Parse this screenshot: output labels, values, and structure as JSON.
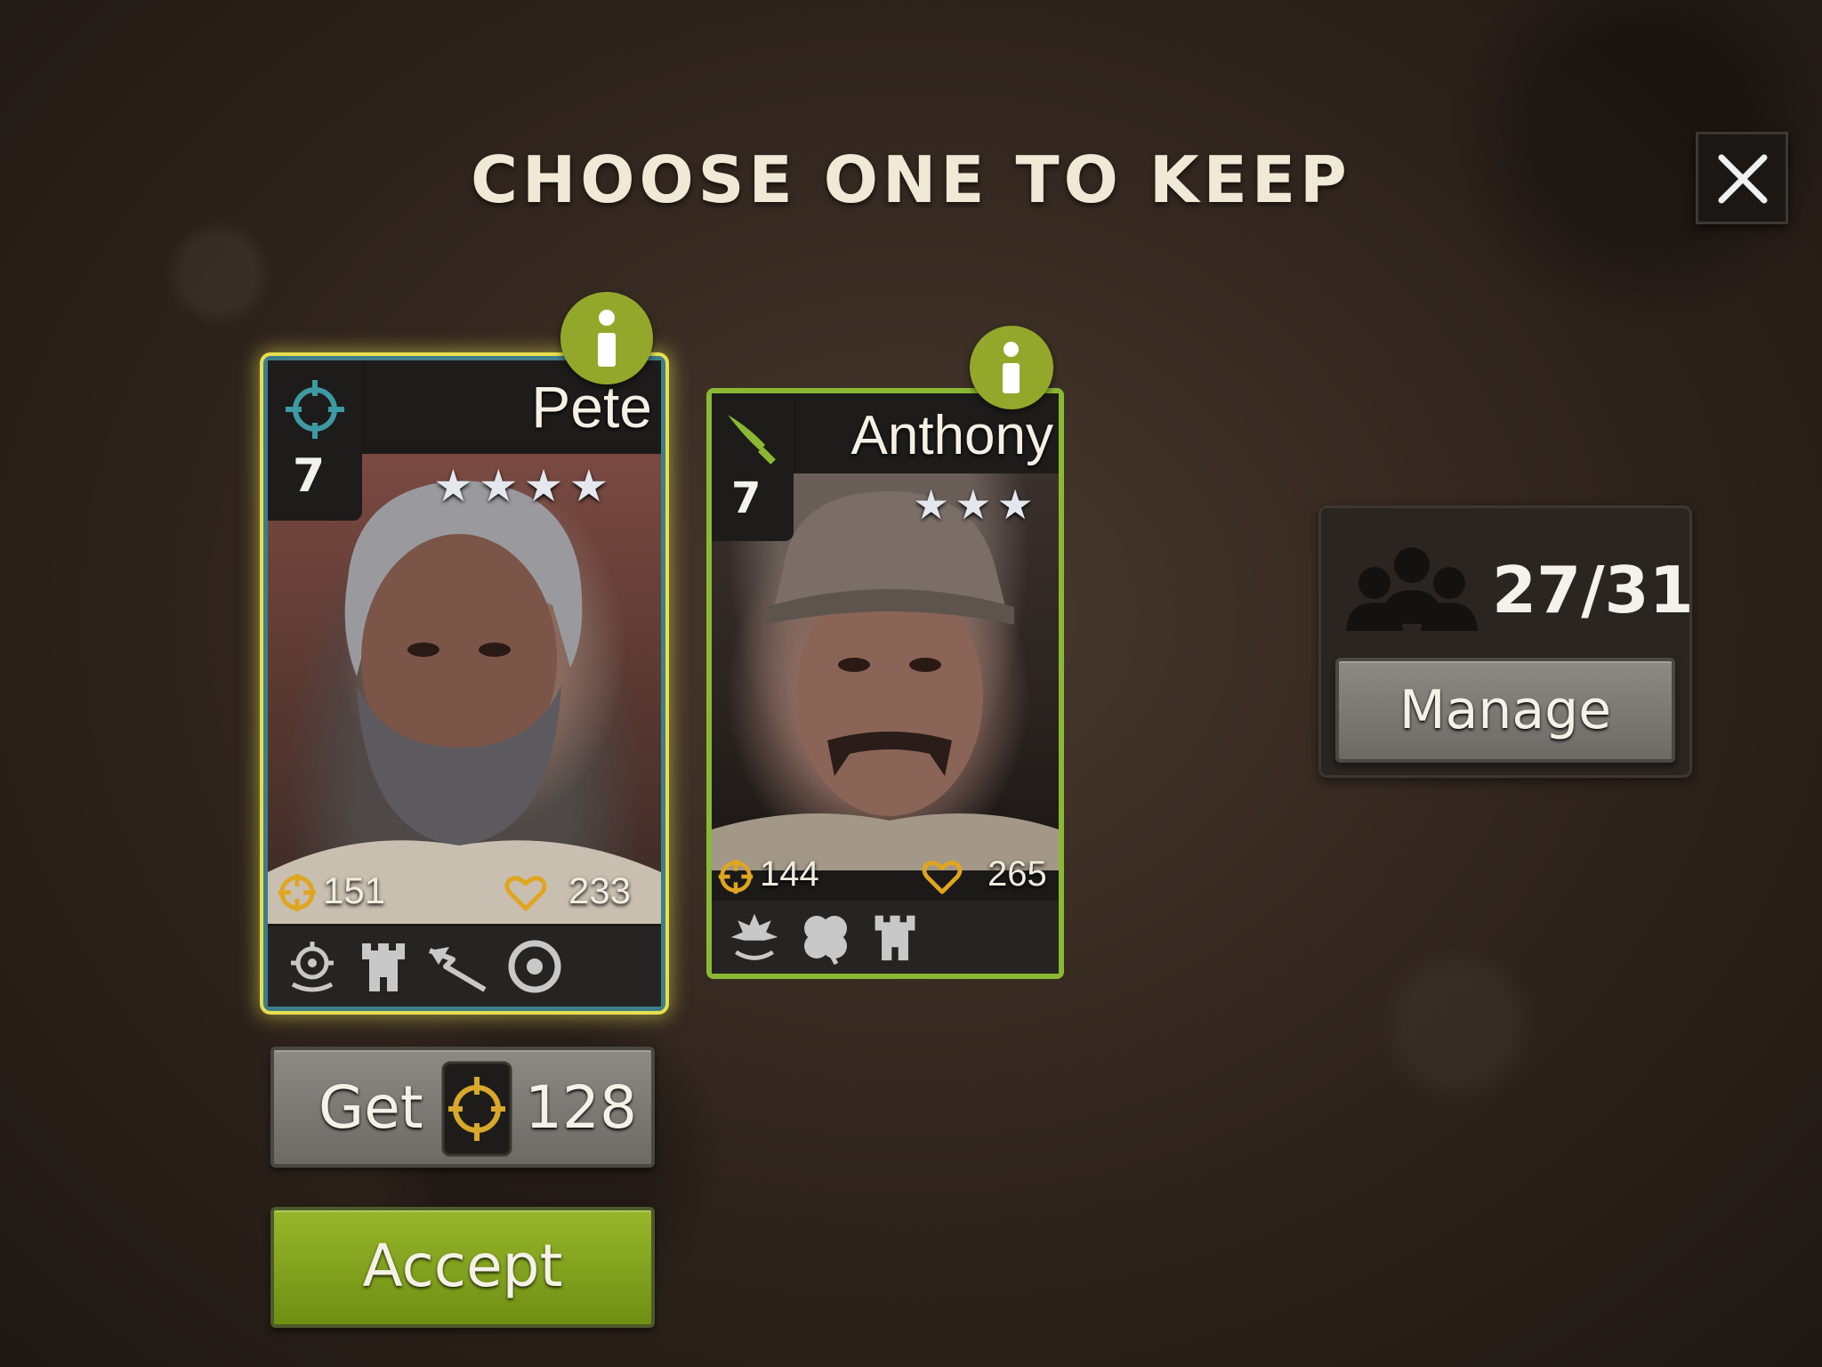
{
  "header": {
    "title": "CHOOSE ONE TO KEEP",
    "close_icon": "close-icon"
  },
  "cards": [
    {
      "name": "Pete",
      "level": "7",
      "stars": 4,
      "class_icon": "crosshair-icon",
      "attack": "151",
      "health": "233",
      "traits": [
        "target-swap-icon",
        "tower-icon",
        "ricochet-arrow-icon",
        "bullseye-icon"
      ],
      "selected": true,
      "border_color": "#3e7d8a"
    },
    {
      "name": "Anthony",
      "level": "7",
      "stars": 3,
      "class_icon": "machete-icon",
      "attack": "144",
      "health": "265",
      "traits": [
        "burst-swap-icon",
        "clover-icon",
        "tower-icon"
      ],
      "selected": false,
      "border_color": "#8ab833"
    }
  ],
  "roster": {
    "count": "27/31",
    "manage_label": "Manage",
    "icon": "survivors-group-icon"
  },
  "get_button": {
    "label": "Get",
    "amount": "128",
    "icon": "crosshair-token-icon"
  },
  "accept_button": {
    "label": "Accept"
  },
  "colors": {
    "accent_green": "#93a82a",
    "selected_glow": "#e6de4e",
    "title": "#efe9d6"
  }
}
